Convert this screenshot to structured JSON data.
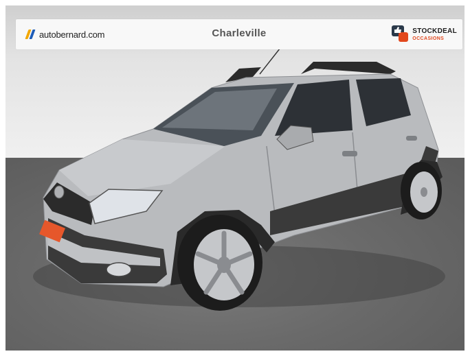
{
  "banner": {
    "brand": {
      "name": "autobernard.com",
      "logo_icon": "autobernard-slash-logo-icon",
      "colors": {
        "accent_orange": "#f2a700",
        "accent_blue": "#1e5db8"
      }
    },
    "location": "Charleville",
    "partner": {
      "name": "STOCKDEAL",
      "subtitle": "OCCASIONS",
      "logo_icon": "stockdeal-thumbs-up-icon",
      "colors": {
        "dark": "#2b3a4a",
        "accent": "#e2481d"
      }
    }
  },
  "photo": {
    "subject_icon": "silver-hatchback-car",
    "colors": {
      "body": "#b9bbbe",
      "trim": "#2a2a2a",
      "floor": "#6a6a6a",
      "wall": "#ececec"
    }
  }
}
